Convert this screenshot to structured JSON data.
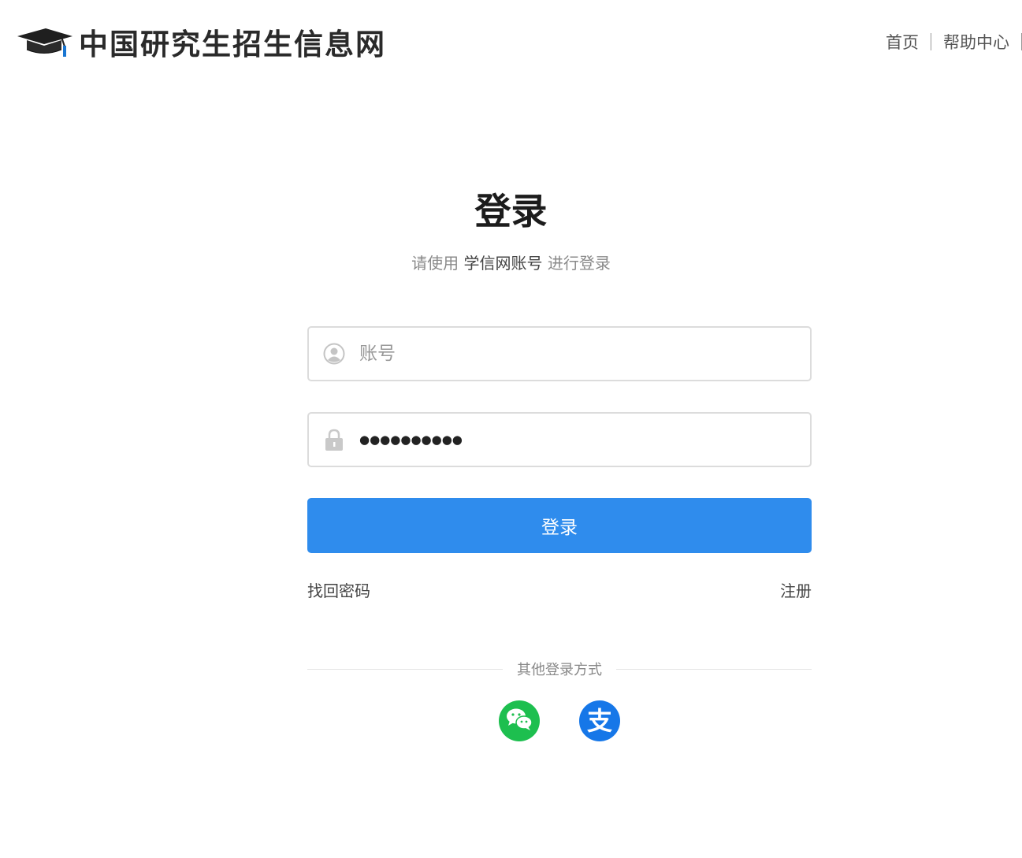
{
  "header": {
    "site_name": "中国研究生招生信息网",
    "nav": [
      {
        "label": "首页"
      },
      {
        "label": "帮助中心"
      }
    ]
  },
  "login": {
    "title": "登录",
    "subtitle_prefix": "请使用",
    "subtitle_account": "学信网账号",
    "subtitle_suffix": "进行登录",
    "account_placeholder": "账号",
    "account_value": "",
    "password_value": "●●●●●●●●●●",
    "submit_label": "登录",
    "forgot_password": "找回密码",
    "register": "注册",
    "other_methods_label": "其他登录方式",
    "other_methods": [
      {
        "name": "wechat",
        "icon": "wechat-icon",
        "color": "#1dbf4f"
      },
      {
        "name": "alipay",
        "icon": "alipay-icon",
        "glyph": "支",
        "color": "#1677e8"
      }
    ]
  },
  "colors": {
    "primary": "#2f8ced",
    "border": "#dcdcdc"
  }
}
